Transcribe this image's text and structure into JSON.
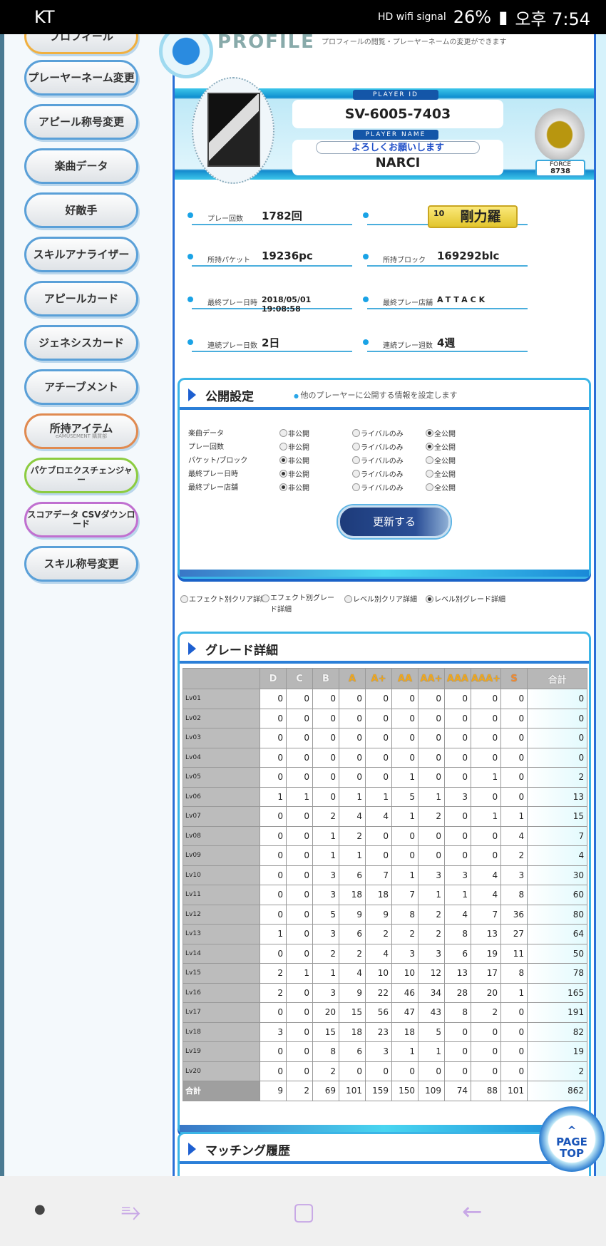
{
  "status_bar": {
    "carrier": "KT",
    "icons": "HD wifi signal",
    "battery": "26%",
    "time": "오후 7:54"
  },
  "sidebar": {
    "items": [
      {
        "label": "プロフィール",
        "color": "#f0b040"
      },
      {
        "label": "プレーヤーネーム変更",
        "color": "#5aa0d8"
      },
      {
        "label": "アピール称号変更",
        "color": "#5aa0d8"
      },
      {
        "label": "楽曲データ",
        "color": "#5aa0d8"
      },
      {
        "label": "好敵手",
        "color": "#5aa0d8"
      },
      {
        "label": "スキルアナライザー",
        "color": "#5aa0d8"
      },
      {
        "label": "アピールカード",
        "color": "#5aa0d8"
      },
      {
        "label": "ジェネシスカード",
        "color": "#5aa0d8"
      },
      {
        "label": "アチーブメント",
        "color": "#5aa0d8"
      },
      {
        "label": "所持アイテム",
        "sub": "eAMUSEMENT 購買部",
        "color": "#e08a50"
      },
      {
        "label": "パケブロエクスチェンジャー",
        "color": "#8ccc40"
      },
      {
        "label": "スコアデータ CSVダウンロード",
        "color": "#c070d0"
      },
      {
        "label": "スキル称号変更",
        "color": "#5aa0d8"
      }
    ]
  },
  "profile": {
    "title": "PROFILE",
    "subtitle": "プロフィールの閲覧・プレーヤーネームの変更ができます",
    "player_id_label": "PLAYER ID",
    "player_id": "SV-6005-7403",
    "player_name_label": "PLAYER NAME",
    "comment": "よろしくお願いします",
    "player_name": "NARCI",
    "force_label": "FORCE",
    "force": "8738",
    "skill_level": "10",
    "skill_title": "剛力羅",
    "stats": {
      "play_count_label": "プレー回数",
      "play_count": "1782回",
      "packets_label": "所持パケット",
      "packets": "19236pc",
      "blocks_label": "所持ブロック",
      "blocks": "169292blc",
      "last_play_label": "最終プレー日時",
      "last_play": "2018/05/01 19:08:58",
      "last_shop_label": "最終プレー店舗",
      "last_shop": "ATTACK",
      "days_label": "連続プレー日数",
      "days": "2日",
      "weeks_label": "連続プレー週数",
      "weeks": "4週"
    }
  },
  "privacy": {
    "title": "公開設定",
    "subtitle": "他のプレーヤーに公開する情報を設定します",
    "options": [
      "非公開",
      "ライバルのみ",
      "全公開"
    ],
    "rows": [
      {
        "label": "楽曲データ",
        "selected": 2
      },
      {
        "label": "プレー回数",
        "selected": 2
      },
      {
        "label": "パケット/ブロック",
        "selected": 0
      },
      {
        "label": "最終プレー日時",
        "selected": 0
      },
      {
        "label": "最終プレー店舗",
        "selected": 0
      }
    ],
    "update_button": "更新する"
  },
  "view_options": {
    "items": [
      "エフェクト別クリア詳細",
      "エフェクト別グレード詳細",
      "レベル別クリア詳細",
      "レベル別グレード詳細"
    ],
    "selected": 3
  },
  "grade": {
    "title": "グレード詳細",
    "columns": [
      "D",
      "C",
      "B",
      "A",
      "A+",
      "AA",
      "AA+",
      "AAA",
      "AAA+",
      "S",
      "合計"
    ],
    "rows": [
      {
        "lv": "Lv01",
        "v": [
          0,
          0,
          0,
          0,
          0,
          0,
          0,
          0,
          0,
          0,
          0
        ]
      },
      {
        "lv": "Lv02",
        "v": [
          0,
          0,
          0,
          0,
          0,
          0,
          0,
          0,
          0,
          0,
          0
        ]
      },
      {
        "lv": "Lv03",
        "v": [
          0,
          0,
          0,
          0,
          0,
          0,
          0,
          0,
          0,
          0,
          0
        ]
      },
      {
        "lv": "Lv04",
        "v": [
          0,
          0,
          0,
          0,
          0,
          0,
          0,
          0,
          0,
          0,
          0
        ]
      },
      {
        "lv": "Lv05",
        "v": [
          0,
          0,
          0,
          0,
          0,
          1,
          0,
          0,
          1,
          0,
          2
        ]
      },
      {
        "lv": "Lv06",
        "v": [
          1,
          1,
          0,
          1,
          1,
          5,
          1,
          3,
          0,
          0,
          13
        ]
      },
      {
        "lv": "Lv07",
        "v": [
          0,
          0,
          2,
          4,
          4,
          1,
          2,
          0,
          1,
          1,
          15
        ]
      },
      {
        "lv": "Lv08",
        "v": [
          0,
          0,
          1,
          2,
          0,
          0,
          0,
          0,
          0,
          4,
          7
        ]
      },
      {
        "lv": "Lv09",
        "v": [
          0,
          0,
          1,
          1,
          0,
          0,
          0,
          0,
          0,
          2,
          4
        ]
      },
      {
        "lv": "Lv10",
        "v": [
          0,
          0,
          3,
          6,
          7,
          1,
          3,
          3,
          4,
          3,
          30
        ]
      },
      {
        "lv": "Lv11",
        "v": [
          0,
          0,
          3,
          18,
          18,
          7,
          1,
          1,
          4,
          8,
          60
        ]
      },
      {
        "lv": "Lv12",
        "v": [
          0,
          0,
          5,
          9,
          9,
          8,
          2,
          4,
          7,
          36,
          80
        ]
      },
      {
        "lv": "Lv13",
        "v": [
          1,
          0,
          3,
          6,
          2,
          2,
          2,
          8,
          13,
          27,
          64
        ]
      },
      {
        "lv": "Lv14",
        "v": [
          0,
          0,
          2,
          2,
          4,
          3,
          3,
          6,
          19,
          11,
          50
        ]
      },
      {
        "lv": "Lv15",
        "v": [
          2,
          1,
          1,
          4,
          10,
          10,
          12,
          13,
          17,
          8,
          78
        ]
      },
      {
        "lv": "Lv16",
        "v": [
          2,
          0,
          3,
          9,
          22,
          46,
          34,
          28,
          20,
          1,
          165
        ]
      },
      {
        "lv": "Lv17",
        "v": [
          0,
          0,
          20,
          15,
          56,
          47,
          43,
          8,
          2,
          0,
          191
        ]
      },
      {
        "lv": "Lv18",
        "v": [
          3,
          0,
          15,
          18,
          23,
          18,
          5,
          0,
          0,
          0,
          82
        ]
      },
      {
        "lv": "Lv19",
        "v": [
          0,
          0,
          8,
          6,
          3,
          1,
          1,
          0,
          0,
          0,
          19
        ]
      },
      {
        "lv": "Lv20",
        "v": [
          0,
          0,
          2,
          0,
          0,
          0,
          0,
          0,
          0,
          0,
          2
        ]
      }
    ],
    "total": {
      "lv": "合計",
      "v": [
        9,
        2,
        69,
        101,
        159,
        150,
        109,
        74,
        88,
        101,
        862
      ]
    }
  },
  "matching": {
    "title": "マッチング履歴"
  },
  "page_top": {
    "line1": "PAGE",
    "line2": "TOP"
  }
}
